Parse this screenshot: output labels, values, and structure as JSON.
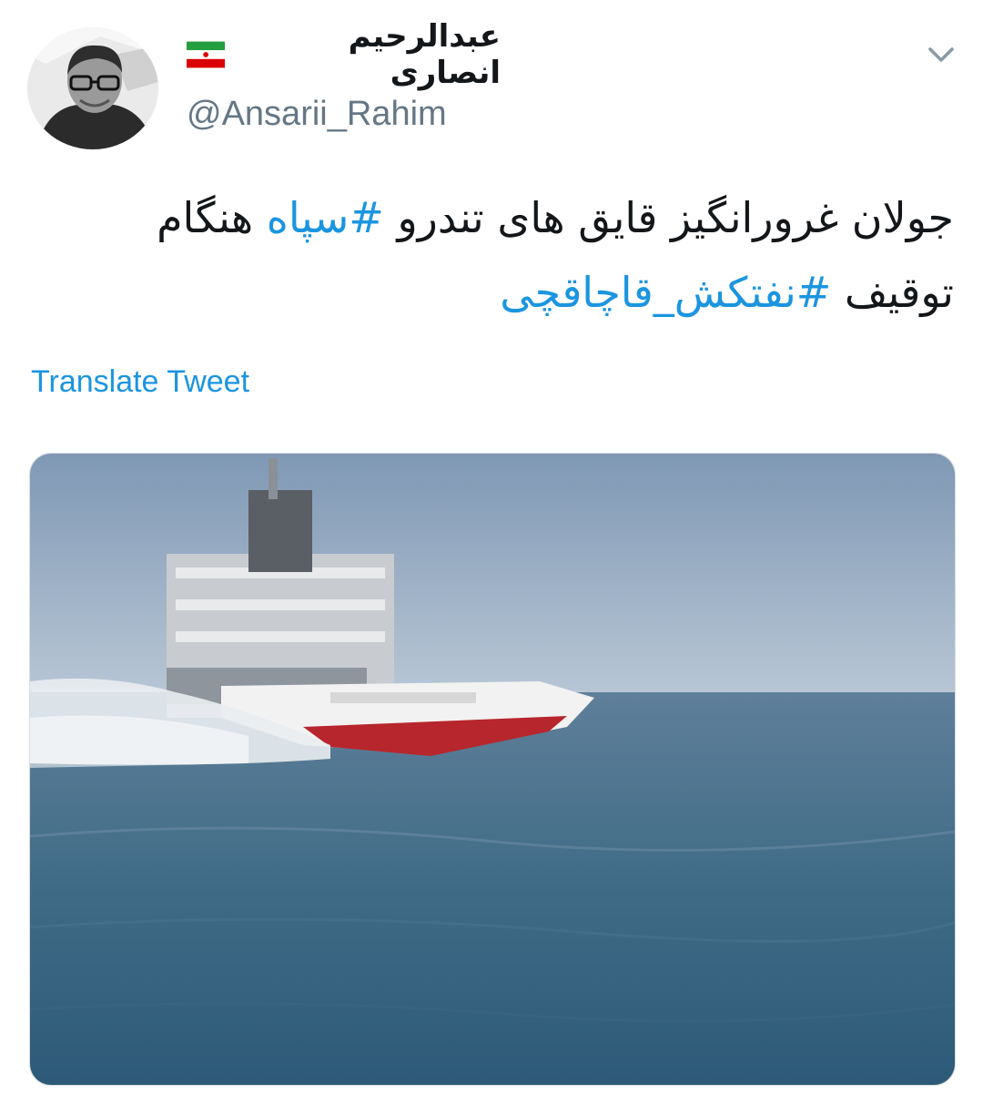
{
  "author": {
    "display_name": "عبدالرحیم انصاری",
    "handle": "@Ansarii_Rahim",
    "flag_icon": "iran-flag-icon",
    "avatar_icon": "profile-photo"
  },
  "menu_icon": "chevron-down-icon",
  "tweet": {
    "line1_text": "جولان غرورانگیز قایق های تندرو ",
    "line1_hashtag": "#سپاه",
    "line1_tail": " هنگام",
    "line2_text": "توقیف ",
    "line2_hashtag": "#نفتکش_قاچاقچی"
  },
  "translate_label": "Translate Tweet",
  "media": {
    "type": "photo",
    "description_icon": "boat-photo"
  },
  "colors": {
    "link": "#1b95e0",
    "secondary_text": "#657786",
    "primary_text": "#14171a"
  }
}
